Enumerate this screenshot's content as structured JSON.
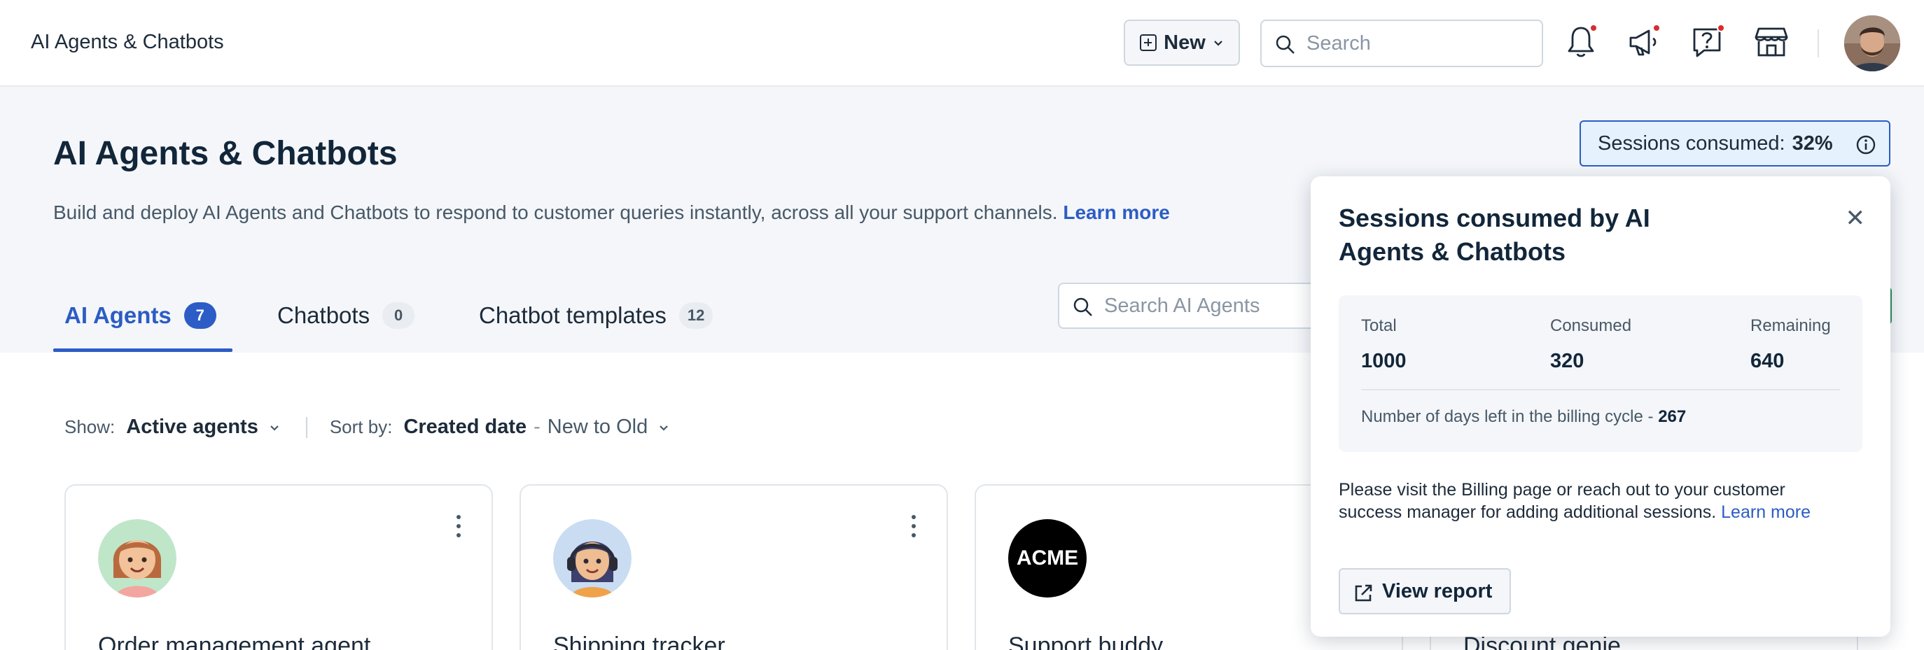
{
  "app": {
    "title": "AI Agents & Chatbots"
  },
  "topbar": {
    "new_label": "New",
    "search_placeholder": "Search",
    "icons": [
      "bell-icon",
      "megaphone-icon",
      "help-icon",
      "store-icon"
    ]
  },
  "header": {
    "title": "AI Agents & Chatbots",
    "description": "Build and deploy AI Agents and Chatbots to respond to customer queries instantly, across all your support channels.",
    "learn_more": "Learn more",
    "sessions_label": "Sessions consumed:",
    "sessions_value": "32%"
  },
  "tabs": [
    {
      "label": "AI Agents",
      "count": "7",
      "active": true
    },
    {
      "label": "Chatbots",
      "count": "0",
      "active": false
    },
    {
      "label": "Chatbot templates",
      "count": "12",
      "active": false
    }
  ],
  "search_agents": {
    "placeholder": "Search AI Agents"
  },
  "filters": {
    "show_label": "Show:",
    "show_value": "Active agents",
    "sort_label": "Sort by:",
    "sort_value": "Created date",
    "sort_dash": "-",
    "sort_order": "New to Old"
  },
  "cards": [
    {
      "name": "Order management agent",
      "avatar": "girl-avatar-icon"
    },
    {
      "name": "Shipping tracker",
      "avatar": "headset-agent-avatar-icon"
    },
    {
      "name": "Support buddy",
      "avatar_text": "ACME"
    },
    {
      "name": "Discount genie"
    }
  ],
  "popover": {
    "title": "Sessions consumed by AI Agents & Chatbots",
    "total_label": "Total",
    "total_value": "1000",
    "consumed_label": "Consumed",
    "consumed_value": "320",
    "remaining_label": "Remaining",
    "remaining_value": "640",
    "days_text": "Number of days left in the billing cycle -",
    "days_value": "267",
    "note": "Please visit the Billing page or reach out to your customer success manager for adding additional sessions.",
    "note_link": "Learn more",
    "view_report": "View report"
  },
  "colors": {
    "accent": "#2c5cc5",
    "title": "#12263a",
    "badge_dot": "#d72d30"
  }
}
